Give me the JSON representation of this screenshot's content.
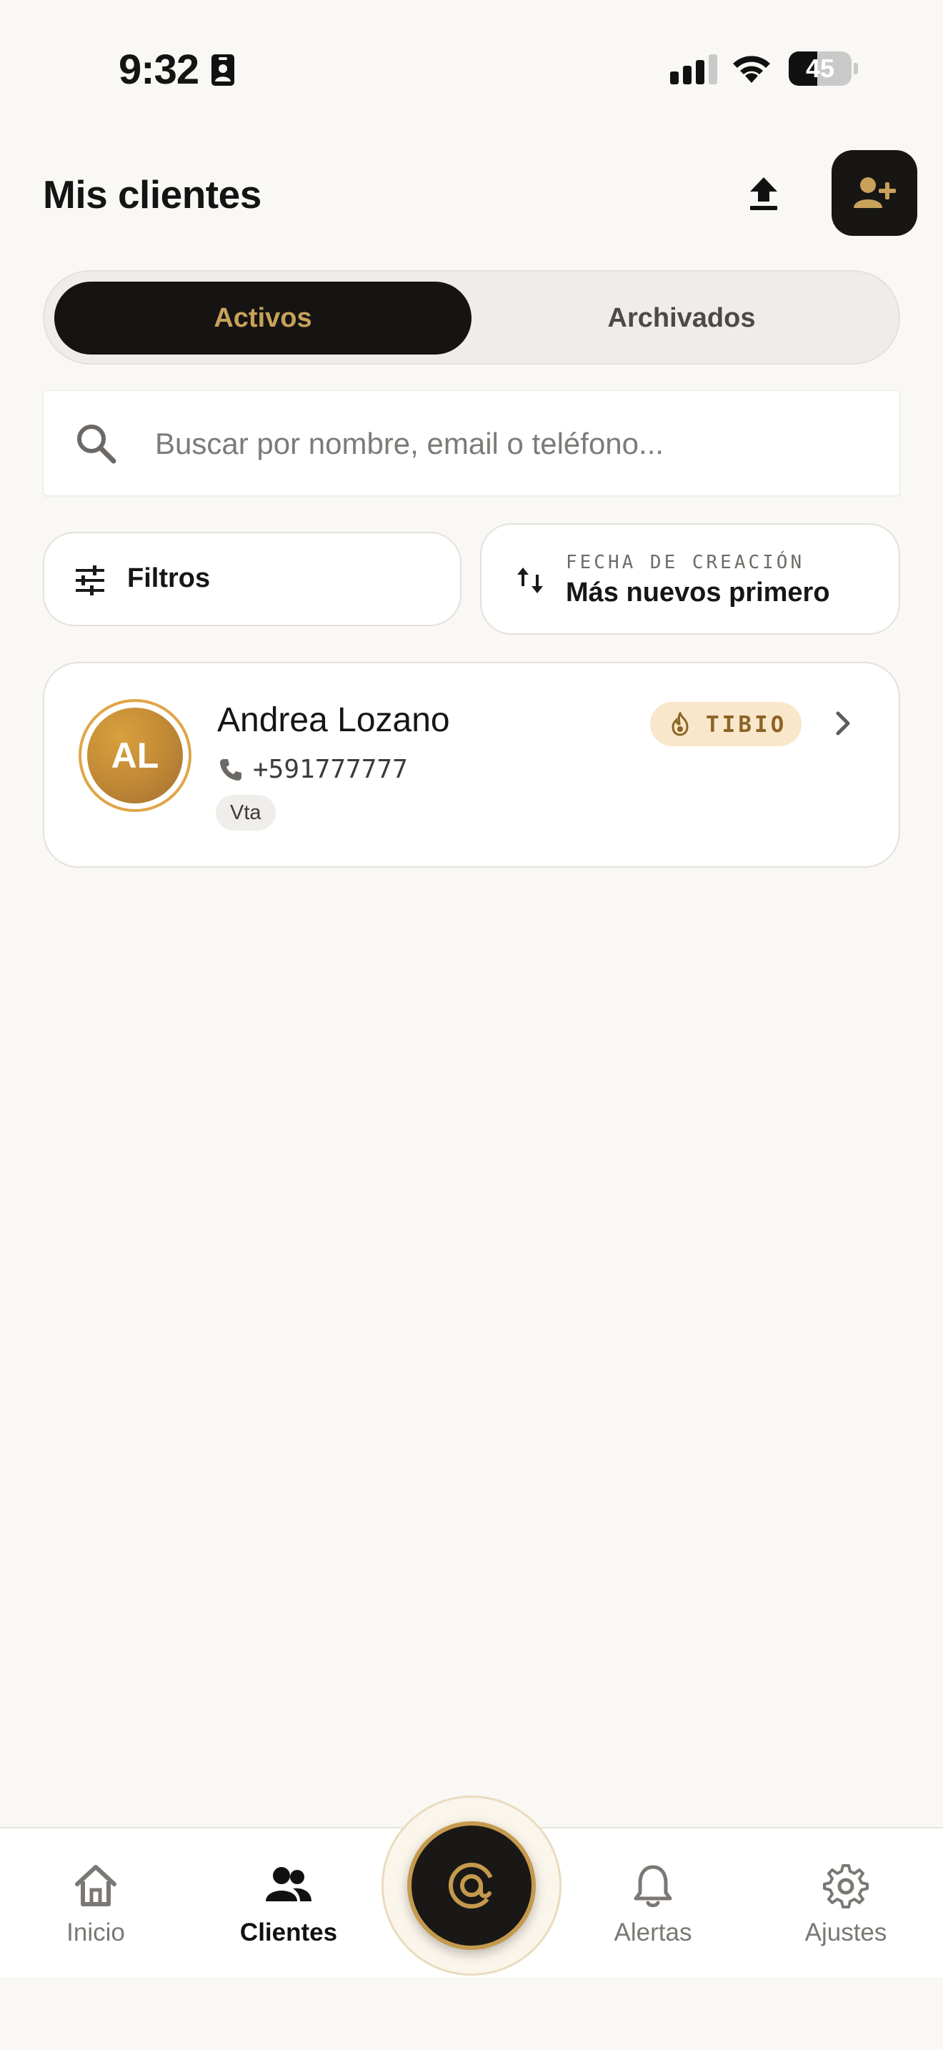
{
  "status_bar": {
    "time": "9:32",
    "battery": "45",
    "battery_level": 0.45
  },
  "header": {
    "title": "Mis clientes"
  },
  "tabs": [
    {
      "label": "Activos",
      "active": true
    },
    {
      "label": "Archivados",
      "active": false
    }
  ],
  "search": {
    "placeholder": "Buscar por nombre, email o teléfono...",
    "value": ""
  },
  "filters": {
    "label": "Filtros"
  },
  "sort": {
    "caption": "FECHA DE CREACIÓN",
    "value": "Más nuevos primero"
  },
  "clients": [
    {
      "initials": "AL",
      "name": "Andrea Lozano",
      "phone": "+591777777",
      "tag": "Vta",
      "temperature": "TIBIO"
    }
  ],
  "nav": {
    "items": [
      {
        "label": "Inicio",
        "icon": "home-icon",
        "active": false
      },
      {
        "label": "Clientes",
        "icon": "users-icon",
        "active": true
      },
      {
        "label": "Alertas",
        "icon": "bell-icon",
        "active": false
      },
      {
        "label": "Ajustes",
        "icon": "gear-icon",
        "active": false
      }
    ],
    "center_icon": "at-sign-icon"
  },
  "colors": {
    "accent_gold": "#c8a25a",
    "dark": "#151412",
    "background": "#f9f8f4",
    "badge_warm": "#f8e7cb"
  }
}
